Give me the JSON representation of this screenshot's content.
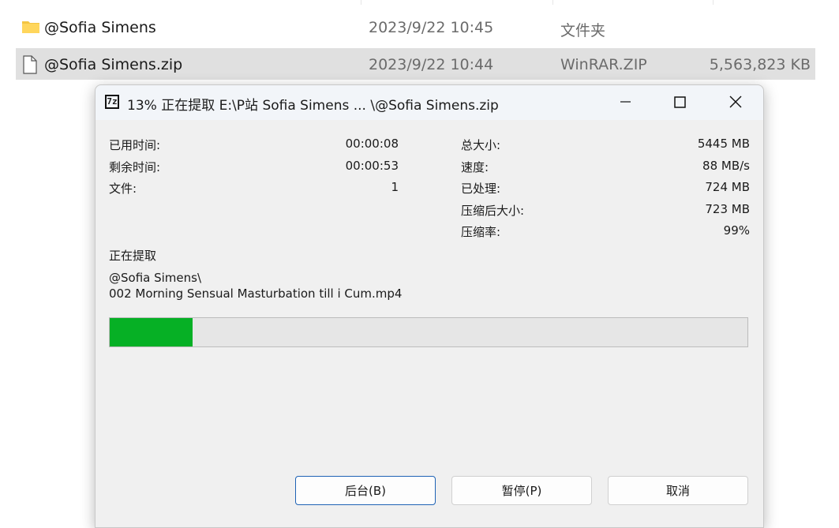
{
  "explorer": {
    "rows": [
      {
        "name": "@Sofia Simens",
        "date": "2023/9/22 10:45",
        "type": "文件夹",
        "size": ""
      },
      {
        "name": "@Sofia Simens.zip",
        "date": "2023/9/22 10:44",
        "type": "WinRAR.ZIP",
        "size": "5,563,823 KB"
      }
    ]
  },
  "dialog": {
    "title": "13% 正在提取 E:\\P站 Sofia Simens ... \\@Sofia Simens.zip",
    "app_icon_text": "7z",
    "stats_left": [
      {
        "label": "已用时间:",
        "value": "00:00:08"
      },
      {
        "label": "剩余时间:",
        "value": "00:00:53"
      },
      {
        "label": "文件:",
        "value": "1"
      }
    ],
    "stats_right": [
      {
        "label": "总大小:",
        "value": "5445 MB"
      },
      {
        "label": "速度:",
        "value": "88 MB/s"
      },
      {
        "label": "已处理:",
        "value": "724 MB"
      },
      {
        "label": "压缩后大小:",
        "value": "723 MB"
      },
      {
        "label": "压缩率:",
        "value": "99%"
      }
    ],
    "status_label": "正在提取",
    "current_folder": "@Sofia Simens\\",
    "current_file": "002 Morning Sensual Masturbation till i Cum.mp4",
    "progress_percent": 13,
    "progress_color": "#06b025",
    "buttons": {
      "background": "后台(B)",
      "pause": "暂停(P)",
      "cancel": "取消"
    }
  }
}
